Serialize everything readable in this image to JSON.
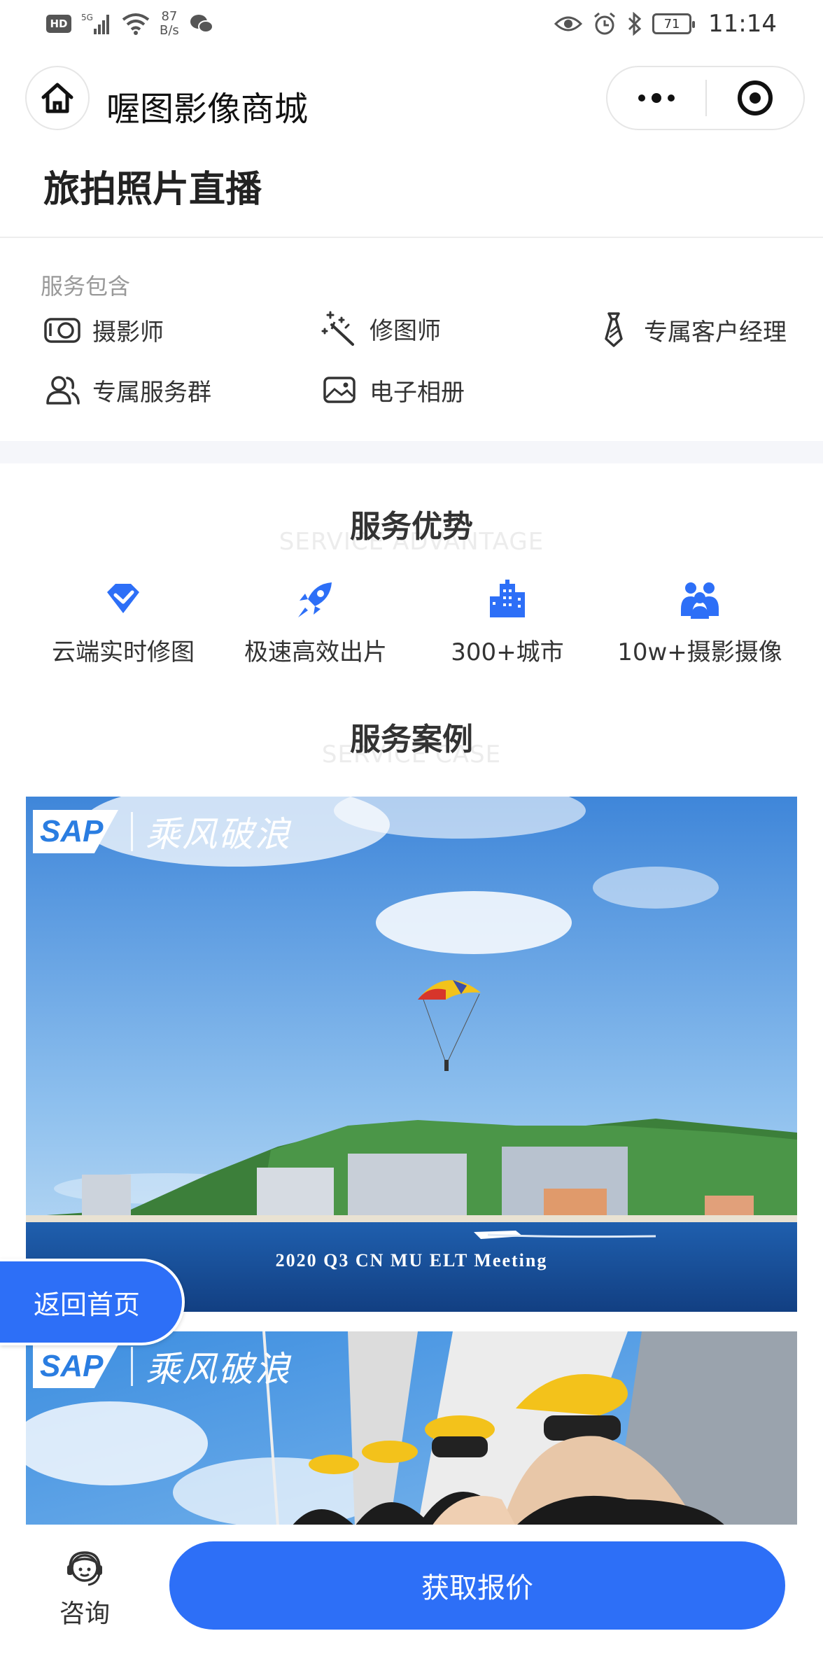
{
  "status_bar": {
    "network": "5G",
    "hd": "HD",
    "speed_value": "87",
    "speed_unit": "B/s",
    "battery": "71",
    "time": "11:14"
  },
  "nav": {
    "title": "喔图影像商城"
  },
  "product": {
    "title": "旅拍照片直播"
  },
  "services": {
    "label": "服务包含",
    "items": [
      {
        "label": "摄影师",
        "icon": "camera-icon"
      },
      {
        "label": "修图师",
        "icon": "magic-wand-icon"
      },
      {
        "label": "专属客户经理",
        "icon": "tie-icon"
      },
      {
        "label": "专属服务群",
        "icon": "group-icon"
      },
      {
        "label": "电子相册",
        "icon": "album-icon"
      }
    ]
  },
  "advantages": {
    "title": "服务优势",
    "subtitle": "SERVICE ADVANTAGE",
    "accent": "#2d6ff7",
    "items": [
      {
        "label": "云端实时修图",
        "icon": "diamond-check-icon"
      },
      {
        "label": "极速高效出片",
        "icon": "rocket-icon"
      },
      {
        "label": "300+城市",
        "icon": "city-icon"
      },
      {
        "label": "10w+摄影摄像",
        "icon": "people-icon"
      }
    ]
  },
  "cases": {
    "title": "服务案例",
    "subtitle": "SERVICE CASE",
    "watermark_logo": "SAP",
    "watermark_text": "乘风破浪",
    "photos": [
      {
        "icon": "parasail-photo",
        "caption": "2020 Q3 CN MU ELT Meeting"
      },
      {
        "icon": "sailing-group-photo",
        "caption": ""
      }
    ]
  },
  "floating": {
    "back_home": "返回首页"
  },
  "bottom": {
    "consult": "咨询",
    "quote": "获取报价",
    "brand_color": "#2d6ff7"
  }
}
